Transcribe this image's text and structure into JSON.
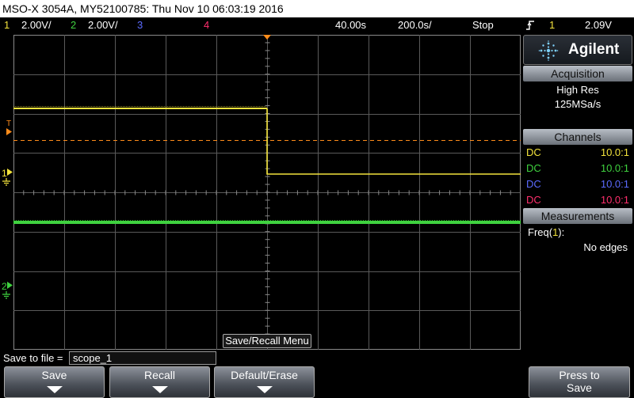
{
  "title": "MSO-X 3054A, MY52100785: Thu Nov 10 06:03:19 2016",
  "status": {
    "ch1_num": "1",
    "ch1_scale": "2.00V/",
    "ch2_num": "2",
    "ch2_scale": "2.00V/",
    "ch3_num": "3",
    "ch4_num": "4",
    "delay": "40.00s",
    "timebase": "200.0s/",
    "run_state": "Stop",
    "trigger_icon": "trigger-edge-icon",
    "trigger_source": "1",
    "trigger_level": "2.09V"
  },
  "colors": {
    "ch1": "#f3e33c",
    "ch2": "#3fd23f",
    "ch3": "#5b6bff",
    "ch4": "#ff2f6d",
    "trigger_marker": "#ff8c1a",
    "grid": "#5a5a5a"
  },
  "markers": {
    "trigger": "T",
    "ch1": "1",
    "ch2": "2"
  },
  "sidebar": {
    "brand": "Agilent",
    "acquisition_title": "Acquisition",
    "acq_mode": "High Res",
    "sample_rate": "125MSa/s",
    "channels_title": "Channels",
    "channels": [
      {
        "coupling": "DC",
        "probe": "10.0:1"
      },
      {
        "coupling": "DC",
        "probe": "10.0:1"
      },
      {
        "coupling": "DC",
        "probe": "10.0:1"
      },
      {
        "coupling": "DC",
        "probe": "10.0:1"
      }
    ],
    "measurements_title": "Measurements",
    "meas_label": "Freq(",
    "meas_channel": "1",
    "meas_suffix": "):",
    "meas_value": "No edges"
  },
  "menu_label": "Save/Recall Menu",
  "save_file": {
    "label": "Save to file =",
    "value": "scope_1"
  },
  "softkeys": [
    {
      "label": "Save"
    },
    {
      "label": "Recall"
    },
    {
      "label": "Default/Erase"
    },
    {
      "label": "Press to",
      "label2": "Save"
    }
  ]
}
